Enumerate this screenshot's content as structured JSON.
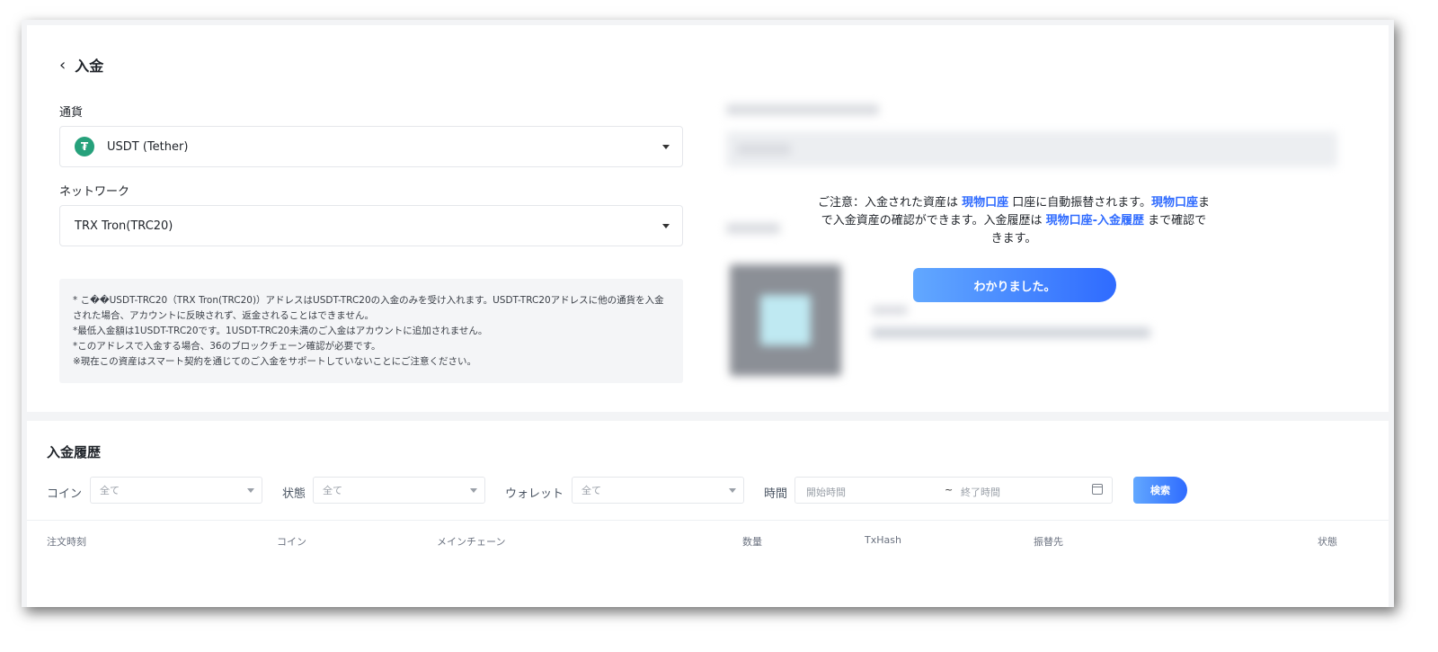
{
  "header": {
    "back_icon": "chevron-left-icon",
    "title": "入金"
  },
  "currency": {
    "label": "通貨",
    "icon": "tether-icon",
    "icon_glyph": "₮",
    "icon_color": "#26a17b",
    "value": "USDT (Tether)"
  },
  "network": {
    "label": "ネットワーク",
    "value": "TRX Tron(TRC20)"
  },
  "notes": [
    "* こ��USDT-TRC20（TRX Tron(TRC20)）アドレスはUSDT-TRC20の入金のみを受け入れます。USDT-TRC20アドレスに他の通貨を入金された場合、アカウントに反映されず、返金されることはできません。",
    "*最低入金額は1USDT-TRC20です。1USDT-TRC20未満のご入金はアカウントに追加されません。",
    "*このアドレスで入金する場合、36のブロックチェーン確認が必要です。",
    "※現在この資産はスマート契約を通じてのご入金をサポートしていないことにご注意ください。"
  ],
  "notice": {
    "t1": "ご注意：入金された資産は ",
    "link1": "現物口座",
    "t2": " 口座に自動振替されます。",
    "link2": "現物口座",
    "t3": "まで入金資産の確認ができます。入金履歴は ",
    "link3": "現物口座-入金履歴",
    "t4": " まで確認できます。",
    "button": "わかりました。"
  },
  "history": {
    "title": "入金履歴",
    "filters": {
      "coin_label": "コイン",
      "coin_value": "全て",
      "status_label": "状態",
      "status_value": "全て",
      "wallet_label": "ウォレット",
      "wallet_value": "全て",
      "time_label": "時間",
      "start_placeholder": "開始時間",
      "separator": "~",
      "end_placeholder": "終了時間",
      "search_button": "検索"
    },
    "columns": [
      "注文時刻",
      "コイン",
      "メインチェーン",
      "数量",
      "TxHash",
      "振替先",
      "状態"
    ]
  },
  "colors": {
    "accent": "#2f6bff",
    "accent_light": "#62a8ff"
  }
}
